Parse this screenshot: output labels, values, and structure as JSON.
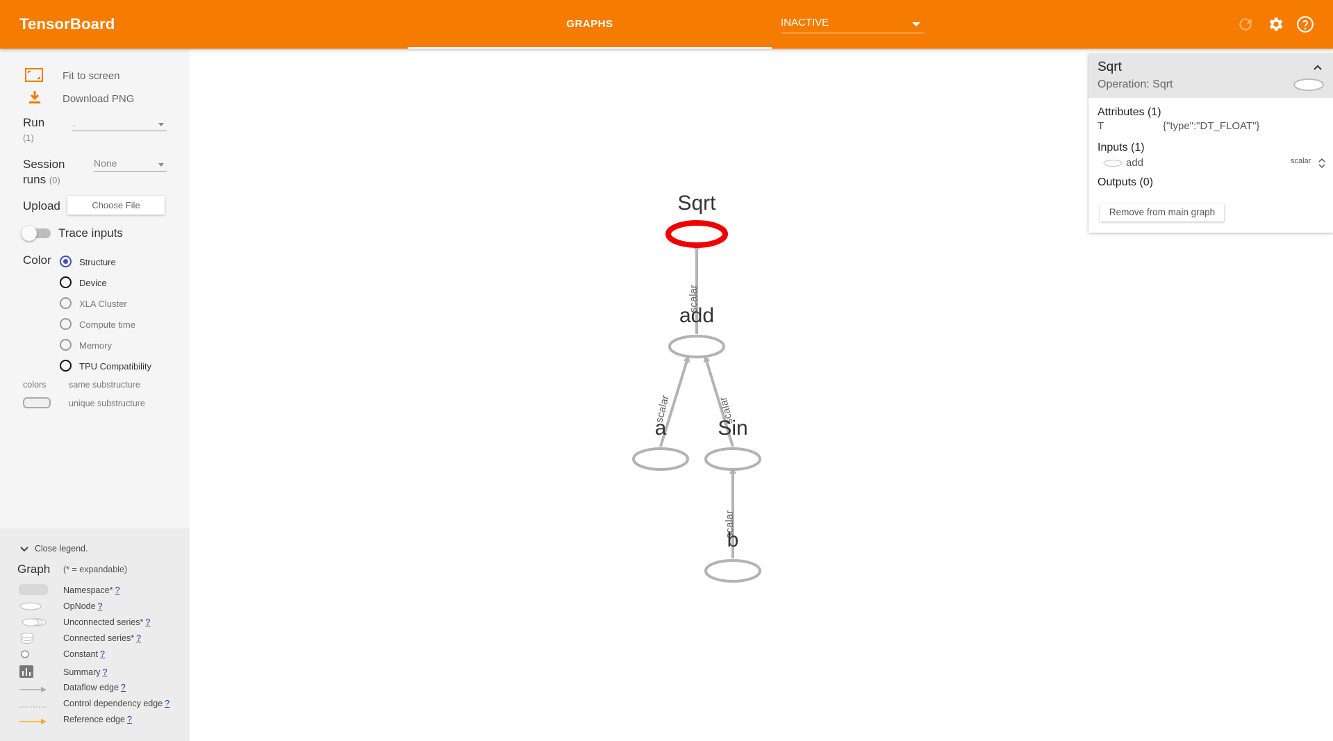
{
  "app": {
    "title": "TensorBoard"
  },
  "header": {
    "tab_label": "GRAPHS",
    "status_select": "INACTIVE"
  },
  "sidebar": {
    "fit_to_screen": "Fit to screen",
    "download_png": "Download PNG",
    "run_label": "Run",
    "run_count": "(1)",
    "run_value": ".",
    "session_label_1": "Session",
    "session_label_2": "runs",
    "session_count": "(0)",
    "session_value": "None",
    "upload_label": "Upload",
    "choose_file": "Choose File",
    "trace_inputs": "Trace inputs",
    "color_label": "Color",
    "color_options": [
      "Structure",
      "Device",
      "XLA Cluster",
      "Compute time",
      "Memory",
      "TPU Compatibility"
    ],
    "colors_label": "colors",
    "same_substructure": "same substructure",
    "unique_substructure": "unique substructure"
  },
  "legend": {
    "close": "Close legend.",
    "graph_label": "Graph",
    "expandable_note": "(* = expandable)",
    "help_mark": "?",
    "items": [
      "Namespace*",
      "OpNode",
      "Unconnected series*",
      "Connected series*",
      "Constant",
      "Summary",
      "Dataflow edge",
      "Control dependency edge",
      "Reference edge"
    ]
  },
  "info_card": {
    "title": "Sqrt",
    "operation": "Operation: Sqrt",
    "attributes_header": "Attributes (1)",
    "attr_key": "T",
    "attr_value": "{\"type\":\"DT_FLOAT\"}",
    "inputs_header": "Inputs (1)",
    "input_name": "add",
    "input_shape": "scalar",
    "outputs_header": "Outputs (0)",
    "remove_button": "Remove from main graph"
  },
  "graph": {
    "nodes": [
      "Sqrt",
      "add",
      "a",
      "Sin",
      "b"
    ],
    "edge_label": "scalar",
    "selected_node": "Sqrt",
    "selected_color": "#f00000",
    "node_color": "#b3b3b3"
  },
  "colors": {
    "accent": "#f57c00",
    "radio_checked": "#3f51b5"
  }
}
